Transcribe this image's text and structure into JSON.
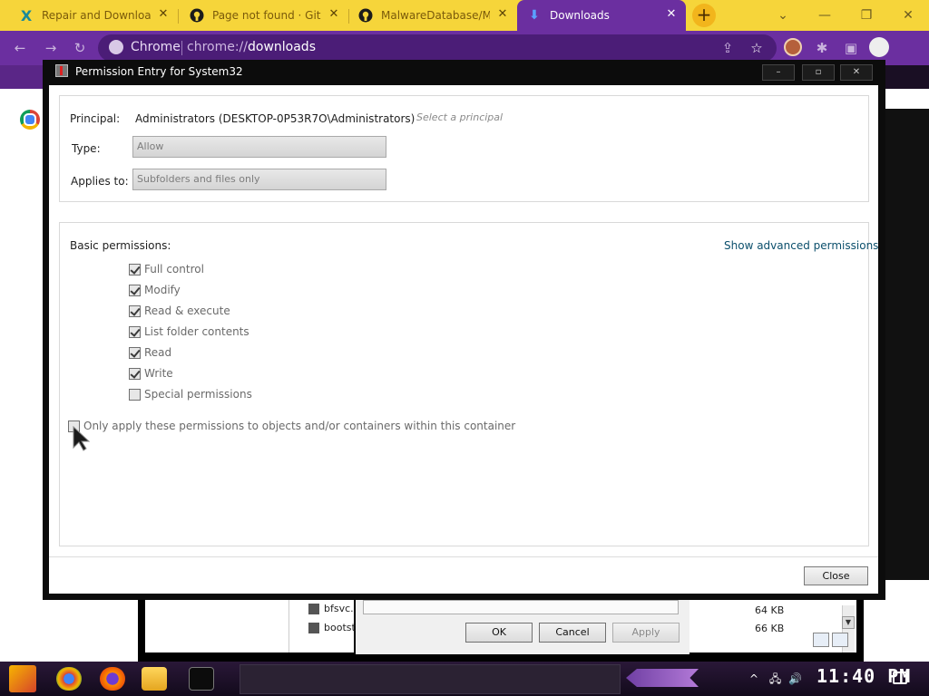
{
  "browser": {
    "tabs": [
      {
        "label": "Repair and Download",
        "icon": "x-logo-icon"
      },
      {
        "label": "Page not found · GitH",
        "icon": "github-icon"
      },
      {
        "label": "MalwareDatabase/ME",
        "icon": "github-icon"
      },
      {
        "label": "Downloads",
        "icon": "download-icon",
        "active": true
      }
    ],
    "omnibox": {
      "site": "Chrome",
      "url_prefix": "chrome://",
      "url_path": "downloads"
    }
  },
  "dialog": {
    "title": "Permission Entry for System32",
    "principal_label": "Principal:",
    "principal_value": "Administrators (DESKTOP-0P53R7O\\Administrators)",
    "select_principal": "Select a principal",
    "type_label": "Type:",
    "type_value": "Allow",
    "applies_label": "Applies to:",
    "applies_value": "Subfolders and files only",
    "basic_permissions_label": "Basic permissions:",
    "show_advanced": "Show advanced permissions",
    "permissions": [
      {
        "label": "Full control",
        "checked": true
      },
      {
        "label": "Modify",
        "checked": true
      },
      {
        "label": "Read & execute",
        "checked": true
      },
      {
        "label": "List folder contents",
        "checked": true
      },
      {
        "label": "Read",
        "checked": true
      },
      {
        "label": "Write",
        "checked": true
      },
      {
        "label": "Special permissions",
        "checked": false
      }
    ],
    "only_apply_label": "Only apply these permissions to objects and/or containers within this container",
    "only_apply_checked": false,
    "close_label": "Close"
  },
  "background": {
    "files": [
      {
        "name": "bfsvc.",
        "size": "64 KB"
      },
      {
        "name": "bootst",
        "size": "66 KB"
      }
    ],
    "security_buttons": {
      "ok": "OK",
      "cancel": "Cancel",
      "apply": "Apply"
    }
  },
  "taskbar": {
    "clock": "11:40 PM"
  },
  "colors": {
    "tabstrip": "#f6d53a",
    "toolbar": "#6b2fa0",
    "link": "#0b4f6c"
  }
}
